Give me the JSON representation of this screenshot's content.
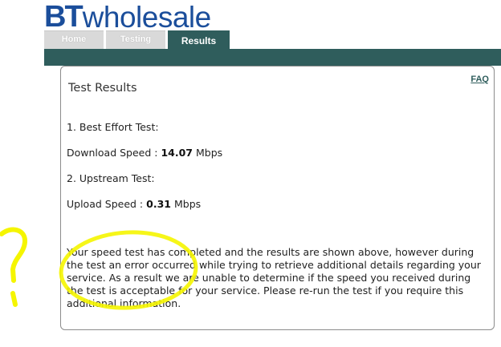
{
  "header": {
    "logo_bt": "BT",
    "logo_wholesale": "wholesale",
    "brand_color": "#1b4e9b",
    "accent_color": "#2f5d5c"
  },
  "tabs": [
    {
      "label": "Home",
      "active": false
    },
    {
      "label": "Testing",
      "active": false
    },
    {
      "label": "Results",
      "active": true
    }
  ],
  "panel": {
    "faq_label": "FAQ",
    "title": "Test Results",
    "test1_heading": "1. Best Effort Test:",
    "download_label": "Download Speed :",
    "download_value": "14.07",
    "download_unit": "Mbps",
    "test2_heading": "2. Upstream Test:",
    "upload_label": "Upload Speed :",
    "upload_value": "0.31",
    "upload_unit": "Mbps",
    "message": "Your speed test has completed and the results are shown above, however during the test an error occurred while trying to retrieve additional details regarding your service. As a result we are unable to determine if the speed you received during the test is acceptable for your service. Please re-run the test if you require this additional information."
  },
  "annotation": {
    "mark": "?",
    "color": "#f5f500"
  }
}
